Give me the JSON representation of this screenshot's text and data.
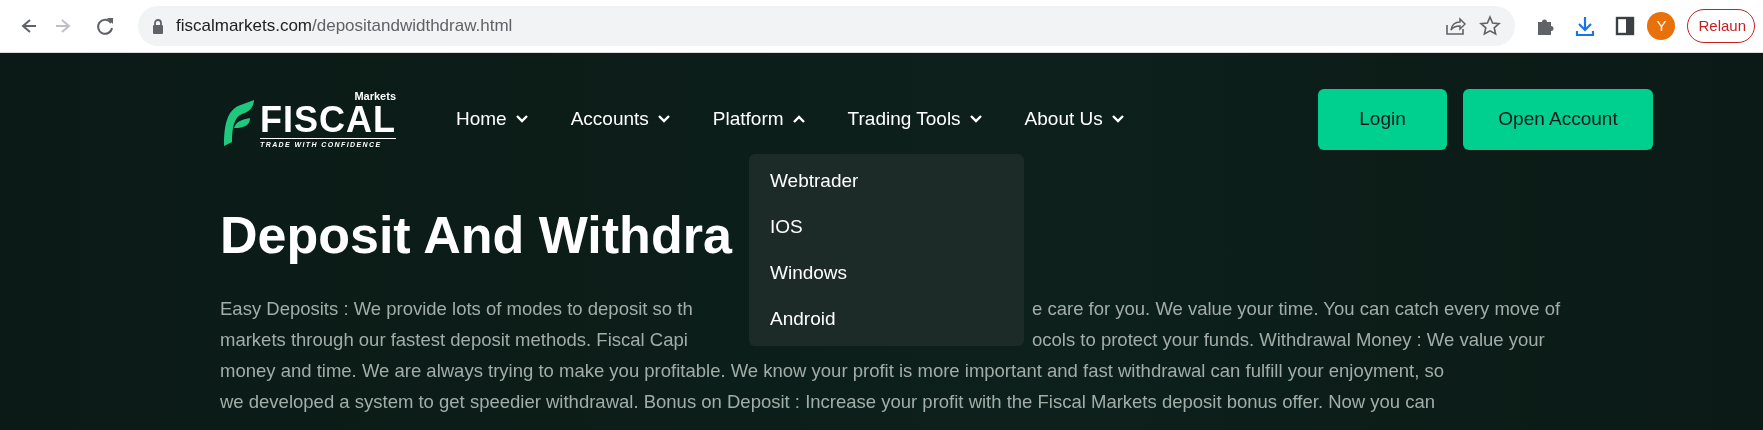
{
  "browser": {
    "nav_buttons": [
      {
        "kind": "back",
        "disabled": false
      },
      {
        "kind": "forward",
        "disabled": true
      },
      {
        "kind": "reload",
        "disabled": false
      }
    ],
    "url": {
      "host": "fiscalmarkets.com",
      "path": "/depositandwidthdraw.html"
    },
    "avatar": "Y",
    "relaunch": "Relaun"
  },
  "logo": {
    "small": "Markets",
    "name": "FISCAL",
    "tagline": "TRADE WITH CONFIDENCE"
  },
  "nav": [
    {
      "label": "Home",
      "expanded": false
    },
    {
      "label": "Accounts",
      "expanded": false
    },
    {
      "label": "Platform",
      "expanded": true
    },
    {
      "label": "Trading Tools",
      "expanded": false
    },
    {
      "label": "About Us",
      "expanded": false
    }
  ],
  "dropdown": [
    "Webtrader",
    "IOS",
    "Windows",
    "Android"
  ],
  "buttons": [
    "Login",
    "Open Account"
  ],
  "heading": "Deposit And Withdra",
  "paragraph_lines": [
    {
      "left": "Easy Deposits : We provide lots of modes to deposit so th",
      "right": "e care for you. We value your time. You can catch every move of"
    },
    {
      "left": "markets through our fastest deposit methods. Fiscal Capi",
      "right": "ocols to protect your funds. Withdrawal Money : We value your"
    },
    {
      "left": "money and time. We are always trying to make you profitable. We know your profit is more important and fast withdrawal can fulfill your enjoyment, so"
    },
    {
      "left": "we developed a system to get speedier withdrawal. Bonus on Deposit : Increase your profit with the Fiscal Markets deposit bonus offer. Now you can"
    }
  ]
}
